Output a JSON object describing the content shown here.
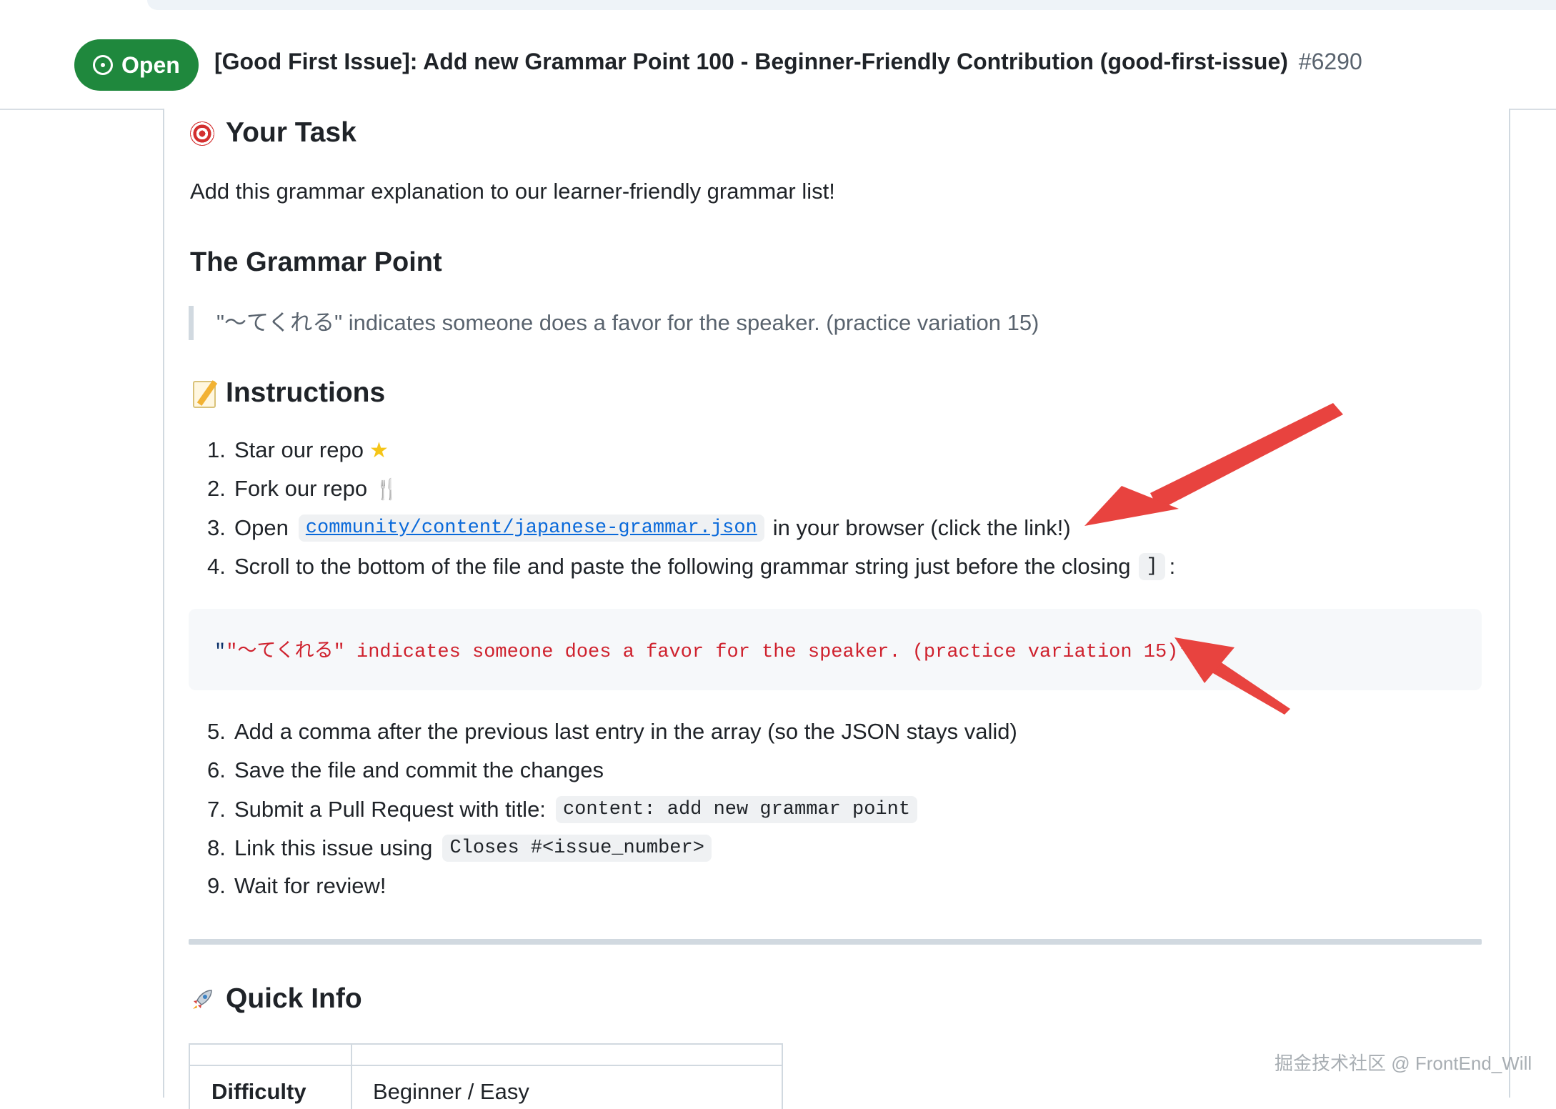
{
  "issue": {
    "status": "Open",
    "title": "[Good First Issue]: Add new Grammar Point 100 - Beginner-Friendly Contribution (good-first-issue)",
    "number": "#6290"
  },
  "sections": {
    "task": {
      "heading": "Your Task",
      "icon": "target-icon",
      "text": "Add this grammar explanation to our learner-friendly grammar list!"
    },
    "grammar": {
      "heading": "The Grammar Point",
      "quote": "\"～てくれる\" indicates someone does a favor for the speaker. (practice variation 15)"
    },
    "instructions": {
      "heading": "Instructions",
      "icon": "memo-icon",
      "items": [
        {
          "num": "1.",
          "text": "Star our repo"
        },
        {
          "num": "2.",
          "text": "Fork our repo"
        },
        {
          "num": "3.",
          "prefix": "Open",
          "link": "community/content/japanese-grammar.json",
          "suffix": "in your browser (click the link!)"
        },
        {
          "num": "4.",
          "text": "Scroll to the bottom of the file and paste the following grammar string just before the closing",
          "code": "]",
          "after": ":"
        },
        {
          "num": "5.",
          "text": "Add a comma after the previous last entry in the array (so the JSON stays valid)"
        },
        {
          "num": "6.",
          "text": "Save the file and commit the changes"
        },
        {
          "num": "7.",
          "text": "Submit a Pull Request with title:",
          "code": "content: add new grammar point"
        },
        {
          "num": "8.",
          "text": "Link this issue using",
          "code": "Closes #<issue_number>"
        },
        {
          "num": "9.",
          "text": "Wait for review!"
        }
      ],
      "code_block": {
        "open_quote": "\"",
        "string": "\"～てくれる\" indicates someone does a favor for the speaker. (practice variation 15)\""
      }
    },
    "quick_info": {
      "heading": "Quick Info",
      "icon": "rocket-icon",
      "table": {
        "label": "Difficulty",
        "value": "Beginner / Easy"
      }
    }
  },
  "annotation_color": "#e8433f",
  "watermark": "掘金技术社区 @ FrontEnd_Will"
}
